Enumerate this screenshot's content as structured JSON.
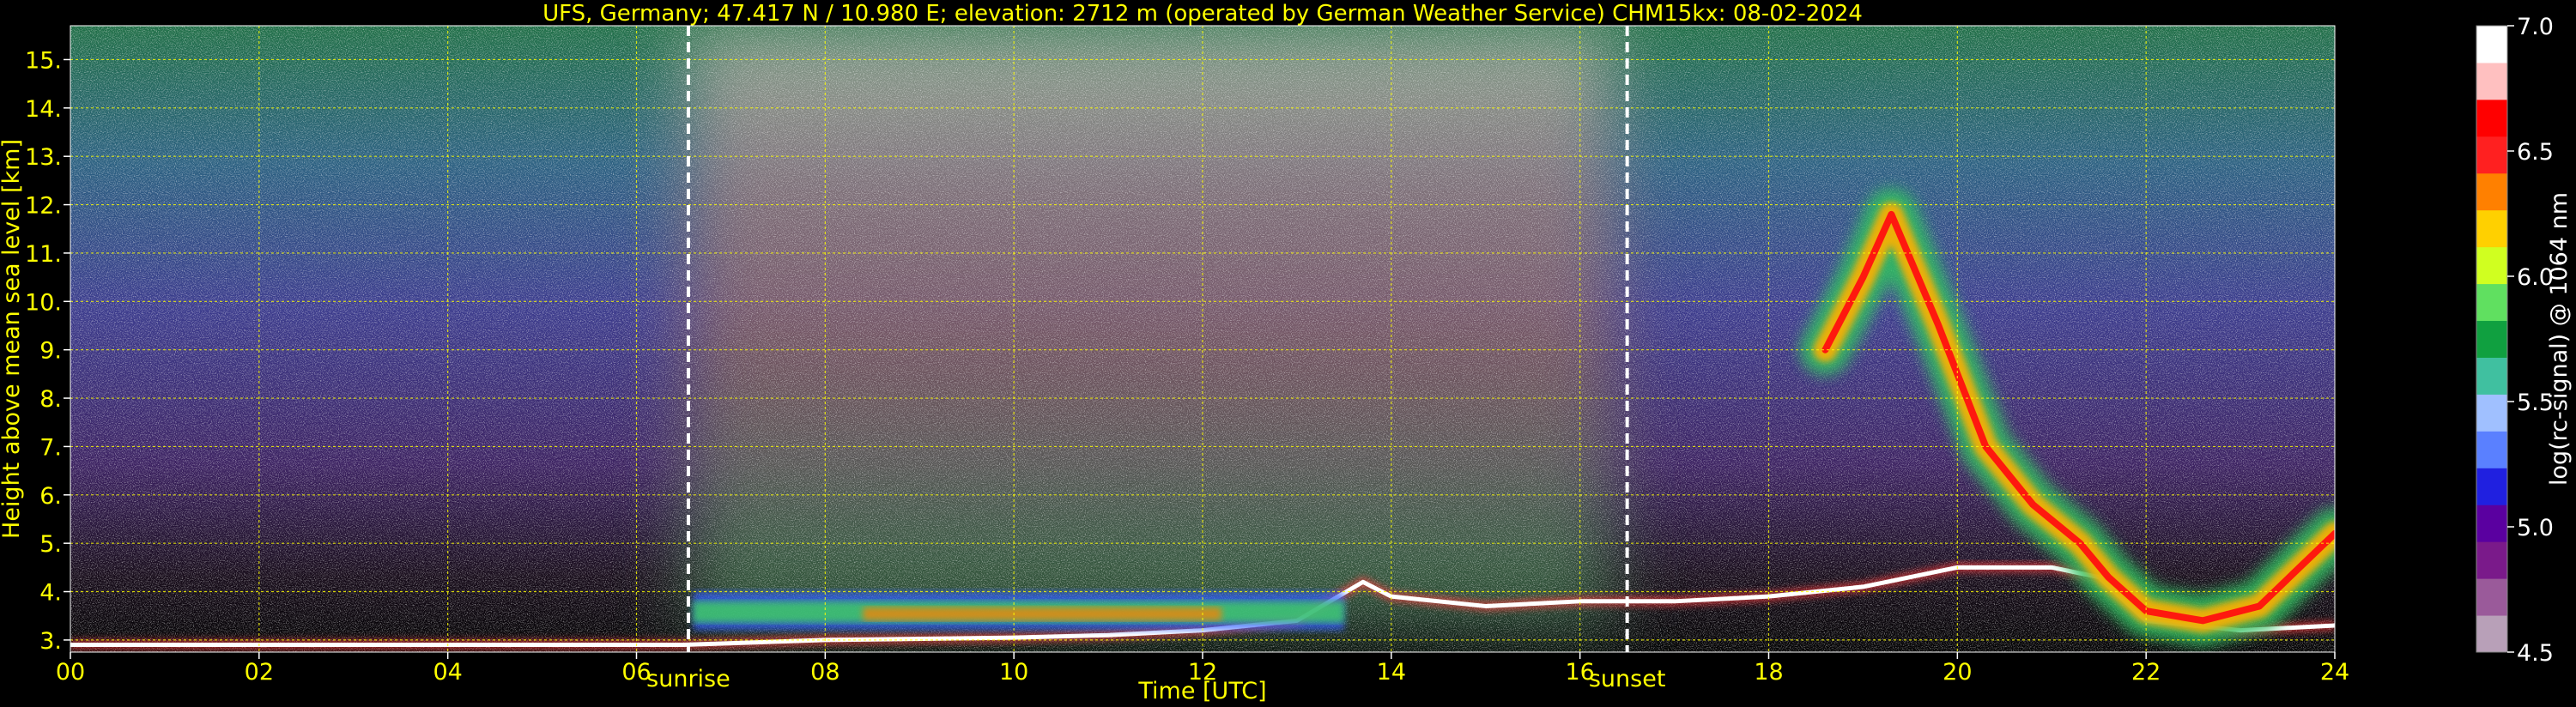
{
  "title": "UFS, Germany; 47.417 N / 10.980 E; elevation: 2712 m  (operated by German Weather Service)    CHM15kx: 08-02-2024",
  "chart_data": {
    "type": "heatmap",
    "xlabel": "Time [UTC]",
    "ylabel": "Height above mean sea level [km]",
    "xlim": [
      0,
      24
    ],
    "ylim": [
      2.75,
      15.7
    ],
    "x_ticks": [
      "00",
      "02",
      "04",
      "06",
      "08",
      "10",
      "12",
      "14",
      "16",
      "18",
      "20",
      "22",
      "24"
    ],
    "x_tick_values": [
      0,
      2,
      4,
      6,
      8,
      10,
      12,
      14,
      16,
      18,
      20,
      22,
      24
    ],
    "y_ticks": [
      "3.",
      "4.",
      "5.",
      "6.",
      "7.",
      "8.",
      "9.",
      "10.",
      "11.",
      "12.",
      "13.",
      "14.",
      "15."
    ],
    "y_tick_values": [
      3,
      4,
      5,
      6,
      7,
      8,
      9,
      10,
      11,
      12,
      13,
      14,
      15
    ],
    "grid": true,
    "annotations": [
      {
        "label": "sunrise",
        "x": 6.55
      },
      {
        "label": "sunset",
        "x": 16.5
      }
    ],
    "colorbar": {
      "label": "log(rc-signal) @ 1064 nm",
      "range": [
        4.5,
        7.0
      ],
      "ticks": [
        "4.5",
        "5.0",
        "5.5",
        "6.0",
        "6.5",
        "7.0"
      ],
      "tick_values": [
        4.5,
        5.0,
        5.5,
        6.0,
        6.5,
        7.0
      ],
      "colors": [
        "#b8a0b8",
        "#9a5a9a",
        "#7a1a8a",
        "#5a00a0",
        "#2020e0",
        "#5a80ff",
        "#a0c0ff",
        "#40c0a0",
        "#10a040",
        "#60e060",
        "#d0ff20",
        "#ffd000",
        "#ff8000",
        "#ff2020",
        "#ff0000",
        "#ffc0c0",
        "#ffffff"
      ]
    },
    "features": [
      {
        "name": "boundary layer top",
        "x": [
          0,
          6.5,
          8,
          10,
          11,
          12,
          13,
          13.7,
          14,
          15,
          16,
          17,
          18,
          19,
          20,
          21,
          21.5,
          22,
          23,
          24
        ],
        "y": [
          2.9,
          2.9,
          3.0,
          3.05,
          3.1,
          3.2,
          3.4,
          4.2,
          3.9,
          3.7,
          3.8,
          3.8,
          3.9,
          4.1,
          4.5,
          4.5,
          4.3,
          3.4,
          3.2,
          3.3
        ]
      },
      {
        "name": "residual layer aerosol",
        "x_range": [
          6.6,
          13.5
        ],
        "y_range": [
          3.2,
          4.0
        ]
      },
      {
        "name": "cirrus cloud",
        "x": [
          18.6,
          19.0,
          19.3,
          19.8,
          20.3,
          20.8,
          21.3,
          21.6,
          22.0,
          22.6,
          23.2,
          24
        ],
        "y": [
          9.0,
          10.5,
          11.8,
          9.5,
          7.0,
          5.8,
          5.0,
          4.3,
          3.6,
          3.4,
          3.7,
          5.2
        ]
      }
    ]
  }
}
